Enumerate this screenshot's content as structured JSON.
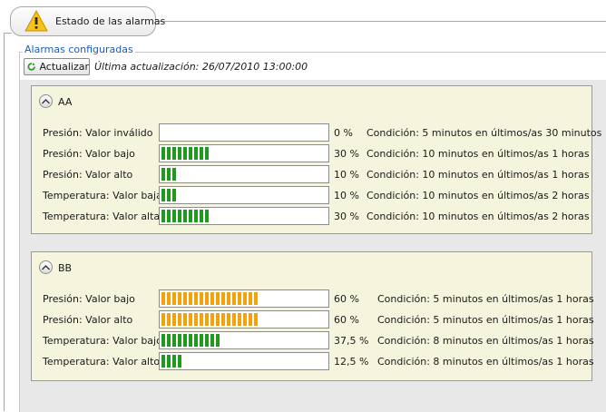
{
  "tab": {
    "title": "Estado de las alarmas",
    "icon": "warning-icon"
  },
  "group": {
    "legend": "Alarmas configuradas",
    "refresh_label": "Actualizar",
    "last_update": "Última actualización: 26/07/2010 13:00:00"
  },
  "panels": [
    {
      "name": "AA",
      "rows": [
        {
          "label": "Presión: Valor inválido",
          "percent": "0 %",
          "level": 0,
          "color": "green",
          "condition": "Condición: 5 minutos en últimos/as 30 minutos"
        },
        {
          "label": "Presión: Valor bajo",
          "percent": "30 %",
          "level": 30,
          "color": "green",
          "condition": "Condición: 10 minutos en últimos/as 1 horas"
        },
        {
          "label": "Presión: Valor alto",
          "percent": "10 %",
          "level": 10,
          "color": "green",
          "condition": "Condición: 10 minutos en últimos/as 1 horas"
        },
        {
          "label": "Temperatura: Valor baja",
          "percent": "10 %",
          "level": 10,
          "color": "green",
          "condition": "Condición: 10 minutos en últimos/as 2 horas"
        },
        {
          "label": "Temperatura: Valor alta",
          "percent": "30 %",
          "level": 30,
          "color": "green",
          "condition": "Condición: 10 minutos en últimos/as 2 horas"
        }
      ]
    },
    {
      "name": "BB",
      "rows": [
        {
          "label": "Presión: Valor bajo",
          "percent": "60 %",
          "level": 60,
          "color": "orange",
          "condition": "Condición: 5 minutos en últimos/as 1 horas"
        },
        {
          "label": "Presión: Valor alto",
          "percent": "60 %",
          "level": 60,
          "color": "orange",
          "condition": "Condición: 5 minutos en últimos/as 1 horas"
        },
        {
          "label": "Temperatura: Valor bajo",
          "percent": "37,5 %",
          "level": 37.5,
          "color": "green",
          "condition": "Condición: 8 minutos en últimos/as 1 horas"
        },
        {
          "label": "Temperatura: Valor alto",
          "percent": "12,5 %",
          "level": 12.5,
          "color": "green",
          "condition": "Condición: 8 minutos en últimos/as 1 horas"
        }
      ]
    }
  ],
  "colors": {
    "green": "#1f9a1f",
    "orange": "#f2a20c",
    "legend_blue": "#1e5cb3",
    "panel_bg": "#f5f4dc"
  }
}
